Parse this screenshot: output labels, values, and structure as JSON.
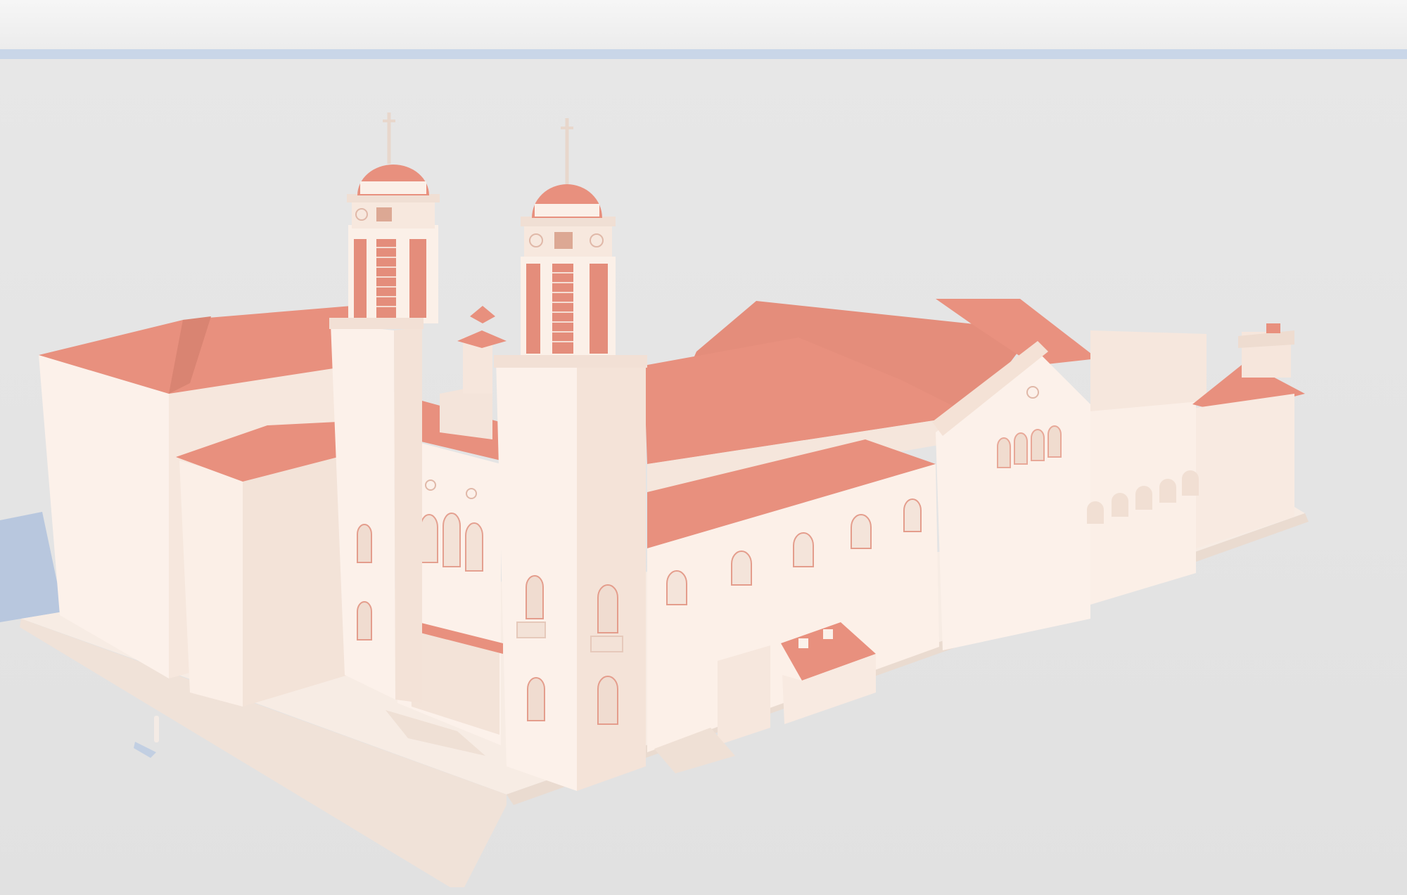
{
  "scene": {
    "subject": "church-building-render",
    "colors": {
      "sky_top": "#f3f3f3",
      "horizon": "#c4d2e6",
      "ground": "#e4e4e4",
      "wall": "#fcefe6",
      "wall_shade": "#f4e2d6",
      "wall_dark": "#ead3c4",
      "roof": "#e8907e",
      "roof_dark": "#d97a68",
      "shadow": "#b7c5dc"
    }
  }
}
